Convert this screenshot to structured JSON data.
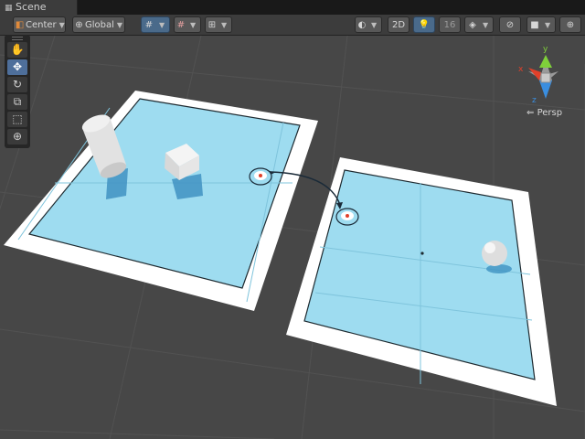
{
  "window": {
    "tab_title": "Scene",
    "tab_icon": "grid-icon"
  },
  "toolbar": {
    "pivot_mode": "Center",
    "pivot_rotation": "Global",
    "mode_2d": "2D",
    "gizmo_count": "16"
  },
  "tools": [
    {
      "name": "hand-tool",
      "icon": "hand-icon",
      "glyph": "✋"
    },
    {
      "name": "move-tool",
      "icon": "move-icon",
      "glyph": "✥",
      "selected": true
    },
    {
      "name": "rotate-tool",
      "icon": "rotate-icon",
      "glyph": "↻"
    },
    {
      "name": "scale-tool",
      "icon": "scale-icon",
      "glyph": "⧉"
    },
    {
      "name": "rect-tool",
      "icon": "rect-tool-icon",
      "glyph": "⬚"
    },
    {
      "name": "transform-tool",
      "icon": "transform-icon",
      "glyph": "⊕"
    }
  ],
  "orientation_gizmo": {
    "axes": {
      "x": "x",
      "y": "y",
      "z": "z"
    },
    "projection_label": "Persp"
  },
  "scene": {
    "objects": [
      "cylinder",
      "cube",
      "sphere",
      "portal-left",
      "portal-right"
    ],
    "colors": {
      "floor": "#9edcf0",
      "border": "#ffffff",
      "background": "#474747",
      "x_axis": "#e0402a",
      "y_axis": "#7fd03a",
      "z_axis": "#3a8ee0"
    }
  }
}
